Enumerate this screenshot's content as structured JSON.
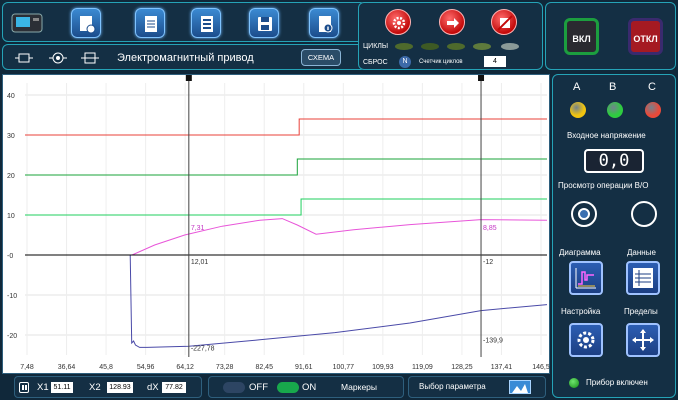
{
  "toolbar": {
    "icons": [
      "device-icon",
      "new-file-icon",
      "document-icon",
      "form-icon",
      "save-icon",
      "info-icon"
    ]
  },
  "sub_toolbar": {
    "title": "Электромагнитный привод",
    "schema_label": "СХЕМА"
  },
  "cycles": {
    "label": "ЦИКЛЫ",
    "reset_label": "СБРОС",
    "reset_badge": "N",
    "counter_label": "Счетчик циклов",
    "counter_value": "4"
  },
  "power": {
    "on_label": "ВКЛ",
    "off_label": "ОТКЛ"
  },
  "right_panel": {
    "phases": [
      {
        "label": "A",
        "color": "#f1c40f"
      },
      {
        "label": "B",
        "color": "#2ecc40"
      },
      {
        "label": "C",
        "color": "#e84a3a"
      }
    ],
    "voltage_label": "Входное напряжение",
    "voltage_value": "0,0",
    "view_label": "Просмотр операции В/О",
    "diagram_label": "Диаграмма",
    "data_label": "Данные",
    "settings_label": "Настройка",
    "limits_label": "Пределы",
    "status_label": "Прибор включен"
  },
  "bottom": {
    "x1_label": "X1",
    "x1_value": "51.11",
    "x2_label": "X2",
    "x2_value": "128.93",
    "dx_label": "dX",
    "dx_value": "77.82",
    "off_label": "OFF",
    "on_label": "ON",
    "markers_label": "Маркеры",
    "param_label": "Выбор параметра"
  },
  "chart_data": {
    "type": "line",
    "xlim": [
      7.48,
      146.5
    ],
    "ylim": [
      -25,
      43
    ],
    "x_ticks": [
      "7,48",
      "36,64",
      "45,8",
      "54,96",
      "64,12",
      "73,28",
      "82,45",
      "91,61",
      "100,77",
      "109,93",
      "119,09",
      "128,25",
      "137,41",
      "146,5"
    ],
    "y_ticks": [
      40,
      30,
      20,
      10,
      0,
      -10,
      -20
    ],
    "y_tick_labels": [
      "40",
      "30",
      "20",
      "10",
      "-0",
      "-10",
      "-20"
    ],
    "grid": true,
    "colors": [
      "#e8403a",
      "#1aa33a",
      "#1fcf5e",
      "#e855d9",
      "#4a4aa8",
      "#000000"
    ],
    "series": [
      {
        "x": [
          7.48,
          80.5,
          80.5,
          146.5
        ],
        "y": [
          30,
          30,
          34,
          34
        ]
      },
      {
        "x": [
          7.48,
          80.0,
          80.0,
          146.5
        ],
        "y": [
          20,
          20,
          24,
          24
        ]
      },
      {
        "x": [
          7.48,
          81.0,
          81.0,
          146.5
        ],
        "y": [
          10,
          10,
          14,
          14
        ]
      },
      {
        "x": [
          7.48,
          36.0,
          42,
          50,
          60,
          70,
          76,
          80,
          85,
          95,
          110,
          128.9,
          146.5
        ],
        "y": [
          0,
          0,
          2.5,
          5,
          7.2,
          8.7,
          9.1,
          7.5,
          5.2,
          6.3,
          7.6,
          8.85,
          8.7
        ]
      },
      {
        "x": [
          7.48,
          35.5,
          35.9,
          36.4,
          36.9,
          38,
          40,
          51.11,
          70,
          90,
          110,
          128.9,
          146.5
        ],
        "y": [
          0,
          0,
          -22,
          -21.5,
          -22.5,
          -23.1,
          -23.1,
          -22.8,
          -21.2,
          -19.4,
          -17,
          -13.9,
          -12.4
        ]
      },
      {
        "x": [
          7.48,
          146.5
        ],
        "y": [
          0,
          0
        ]
      }
    ],
    "markers": [
      {
        "x": 51.11,
        "labels": [
          "7,31",
          "12,01",
          "-227,78"
        ]
      },
      {
        "x": 128.93,
        "labels": [
          "8,85",
          "-12",
          "-139,9"
        ]
      }
    ]
  }
}
